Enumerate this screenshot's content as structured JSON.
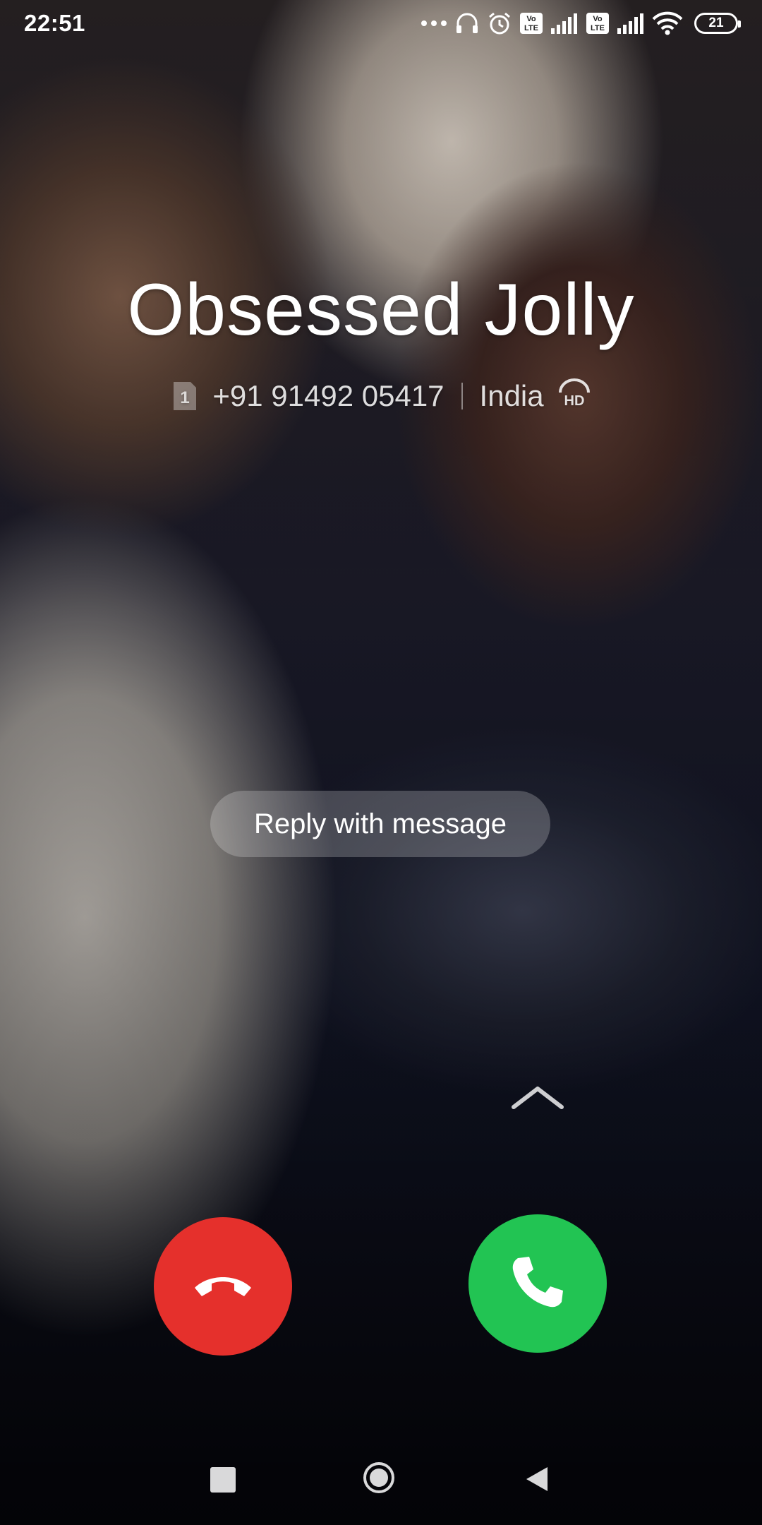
{
  "status_bar": {
    "time": "22:51",
    "icons": [
      "more-dots-icon",
      "headphones-icon",
      "alarm-icon",
      "volte-icon",
      "signal-icon",
      "volte-icon",
      "signal-icon",
      "wifi-icon",
      "battery-icon"
    ],
    "volte_label_top": "Vo",
    "volte_label_bottom": "LTE",
    "battery_level": "21"
  },
  "caller": {
    "name": "Obsessed Jolly",
    "sim_slot": "1",
    "number": "+91 91492 05417",
    "location": "India",
    "hd_label": "HD"
  },
  "actions": {
    "reply_label": "Reply with message",
    "swipe_hint_icon": "chevron-up-icon",
    "decline_icon": "phone-hangup-icon",
    "answer_icon": "phone-answer-icon"
  },
  "colors": {
    "decline": "#e5302c",
    "answer": "#22c453"
  },
  "nav_bar": {
    "icons": [
      "recents-icon",
      "home-icon",
      "back-icon"
    ]
  }
}
